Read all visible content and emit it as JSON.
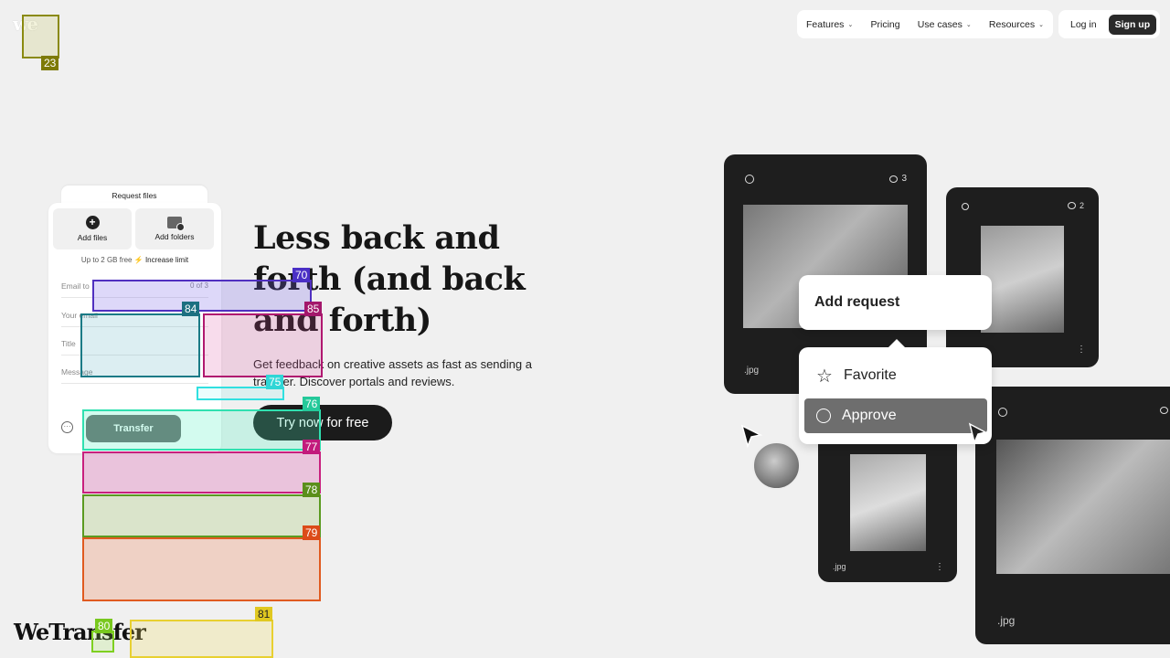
{
  "nav": {
    "logo": "we",
    "items": [
      {
        "label": "Features",
        "dropdown": true
      },
      {
        "label": "Pricing",
        "dropdown": false
      },
      {
        "label": "Use cases",
        "dropdown": true
      },
      {
        "label": "Resources",
        "dropdown": true
      }
    ],
    "login": "Log in",
    "signup": "Sign up"
  },
  "widget": {
    "tab": "Request files",
    "add_files": "Add files",
    "add_folders": "Add folders",
    "limit_text": "Up to 2 GB free",
    "increase_limit": "Increase limit",
    "email_to": "Email to",
    "email_count": "0 of 3",
    "your_email": "Your email",
    "title": "Title",
    "message": "Message",
    "transfer": "Transfer"
  },
  "hero": {
    "title": "Less back and forth (and back and forth)",
    "subtitle": "Get feedback on creative assets as fast as sending a transfer. Discover portals and reviews.",
    "cta": "Try now for free"
  },
  "brand": "WeTransfer",
  "collage": {
    "card1": {
      "comments": "3",
      "ext": ".jpg"
    },
    "card2": {
      "comments": "2"
    },
    "card3": {
      "ext": ".jpg"
    },
    "card4": {
      "ext": ".jpg"
    },
    "add_request": "Add request",
    "menu": [
      "Favorite",
      "Approve"
    ]
  },
  "overlay_tags": [
    "23",
    "70",
    "84",
    "85",
    "75",
    "76",
    "77",
    "78",
    "79",
    "80",
    "81"
  ]
}
